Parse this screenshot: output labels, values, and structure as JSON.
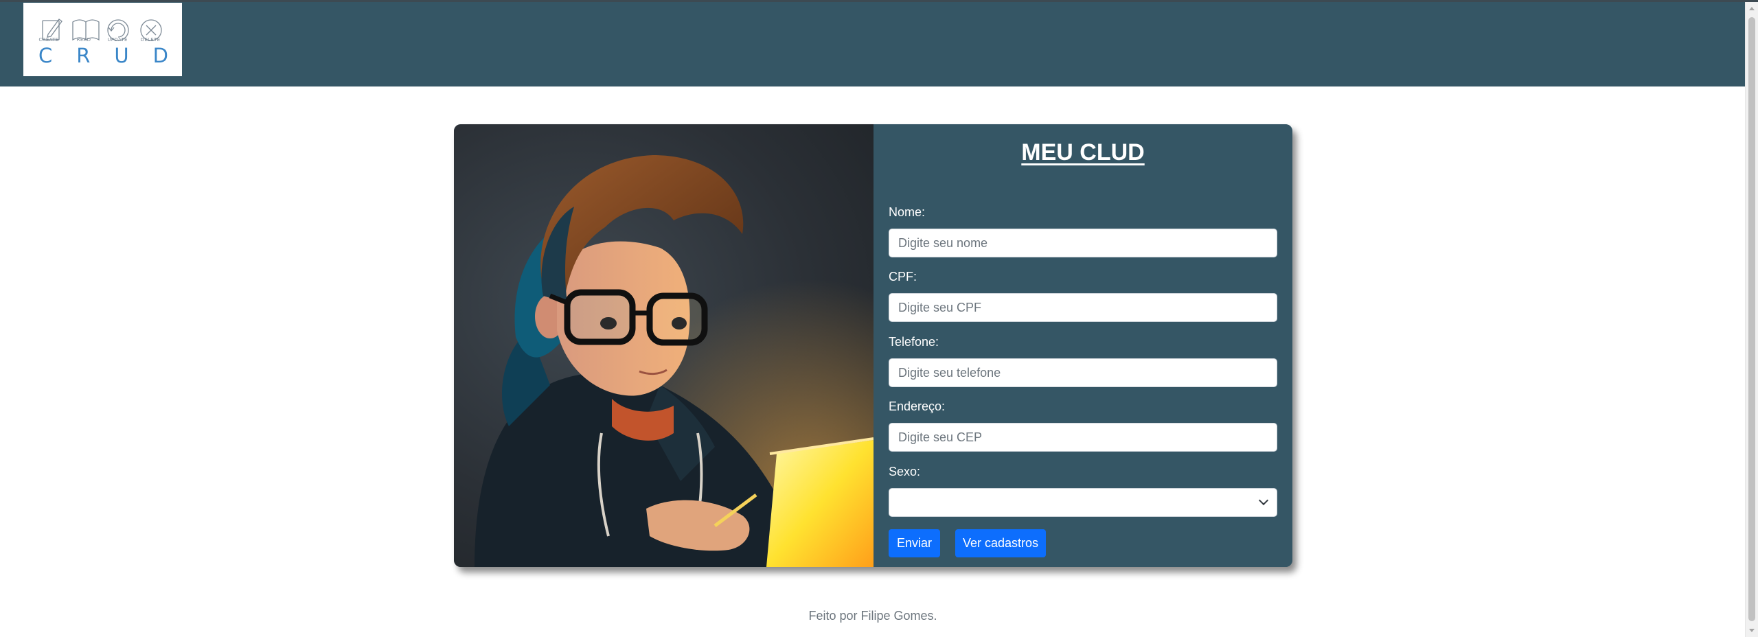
{
  "header": {
    "logo": {
      "captions": [
        "CREATE",
        "READ",
        "UPDATE",
        "DELETE"
      ],
      "letters": [
        "C",
        "R",
        "U",
        "D"
      ]
    }
  },
  "form": {
    "title": "MEU CLUD",
    "fields": [
      {
        "label": "Nome:",
        "placeholder": "Digite seu nome",
        "value": ""
      },
      {
        "label": "CPF:",
        "placeholder": "Digite seu CPF",
        "value": ""
      },
      {
        "label": "Telefone:",
        "placeholder": "Digite seu telefone",
        "value": ""
      },
      {
        "label": "Endereço:",
        "placeholder": "Digite seu CEP",
        "value": ""
      }
    ],
    "sexo": {
      "label": "Sexo:",
      "selected": ""
    },
    "submit_label": "Enviar",
    "view_label": "Ver cadastros"
  },
  "footer": {
    "text": "Feito por Filipe Gomes."
  },
  "colors": {
    "header_bg": "#355665",
    "form_bg": "#355665",
    "button_bg": "#0d6efd",
    "logo_text": "#3a86c8"
  },
  "icons": [
    "create-icon",
    "read-icon",
    "update-icon",
    "delete-icon",
    "chevron-down-icon"
  ]
}
